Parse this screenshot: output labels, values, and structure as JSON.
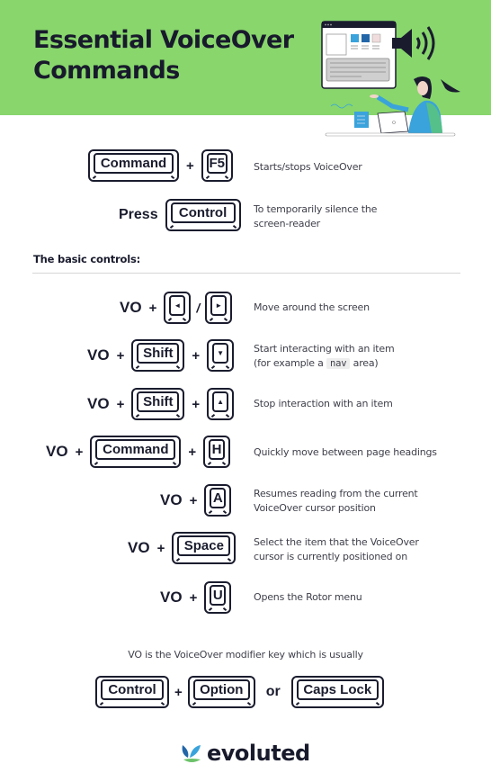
{
  "header": {
    "title_line1": "Essential VoiceOver",
    "title_line2": "Commands",
    "background_color": "#88d66c"
  },
  "intro_commands": [
    {
      "prefix": "",
      "keys": [
        "Command",
        "F5"
      ],
      "separators": [
        "+"
      ],
      "description": "Starts/stops VoiceOver"
    },
    {
      "prefix": "Press",
      "keys": [
        "Control"
      ],
      "separators": [],
      "description_line1": "To temporarily silence the",
      "description_line2": "screen-reader"
    }
  ],
  "section": {
    "label": "The basic controls:"
  },
  "basic_controls": [
    {
      "modifier": "VO",
      "keys": [
        "left-arrow",
        "right-arrow"
      ],
      "key_glyphs": [
        "◄",
        "►"
      ],
      "separator": "/",
      "description": "Move around the screen"
    },
    {
      "modifier": "VO",
      "keys": [
        "Shift",
        "down-arrow"
      ],
      "key_glyphs": [
        "Shift",
        "▼"
      ],
      "description_line1": "Start interacting with an item",
      "description_prefix": "(for example a",
      "description_code": "nav",
      "description_suffix": "area)"
    },
    {
      "modifier": "VO",
      "keys": [
        "Shift",
        "up-arrow"
      ],
      "key_glyphs": [
        "Shift",
        "▲"
      ],
      "description": "Stop interaction with an item"
    },
    {
      "modifier": "VO",
      "keys": [
        "Command",
        "H"
      ],
      "description": "Quickly move between page headings"
    },
    {
      "modifier": "VO",
      "keys": [
        "A"
      ],
      "description_line1": "Resumes reading from the current",
      "description_line2": "VoiceOver cursor position"
    },
    {
      "modifier": "VO",
      "keys": [
        "Space"
      ],
      "description_line1": "Select the item that the VoiceOver",
      "description_line2": "cursor is currently positioned on"
    },
    {
      "modifier": "VO",
      "keys": [
        "U"
      ],
      "description": "Opens the Rotor menu"
    }
  ],
  "symbols": {
    "plus": "+",
    "slash": "/",
    "or": "or"
  },
  "modifier_note": {
    "text": "VO is the VoiceOver modifier key which is usually",
    "keys": [
      "Control",
      "Option",
      "Caps Lock"
    ],
    "joiner_plus": "+",
    "joiner_or": "or"
  },
  "footer": {
    "brand": "evoluted"
  }
}
